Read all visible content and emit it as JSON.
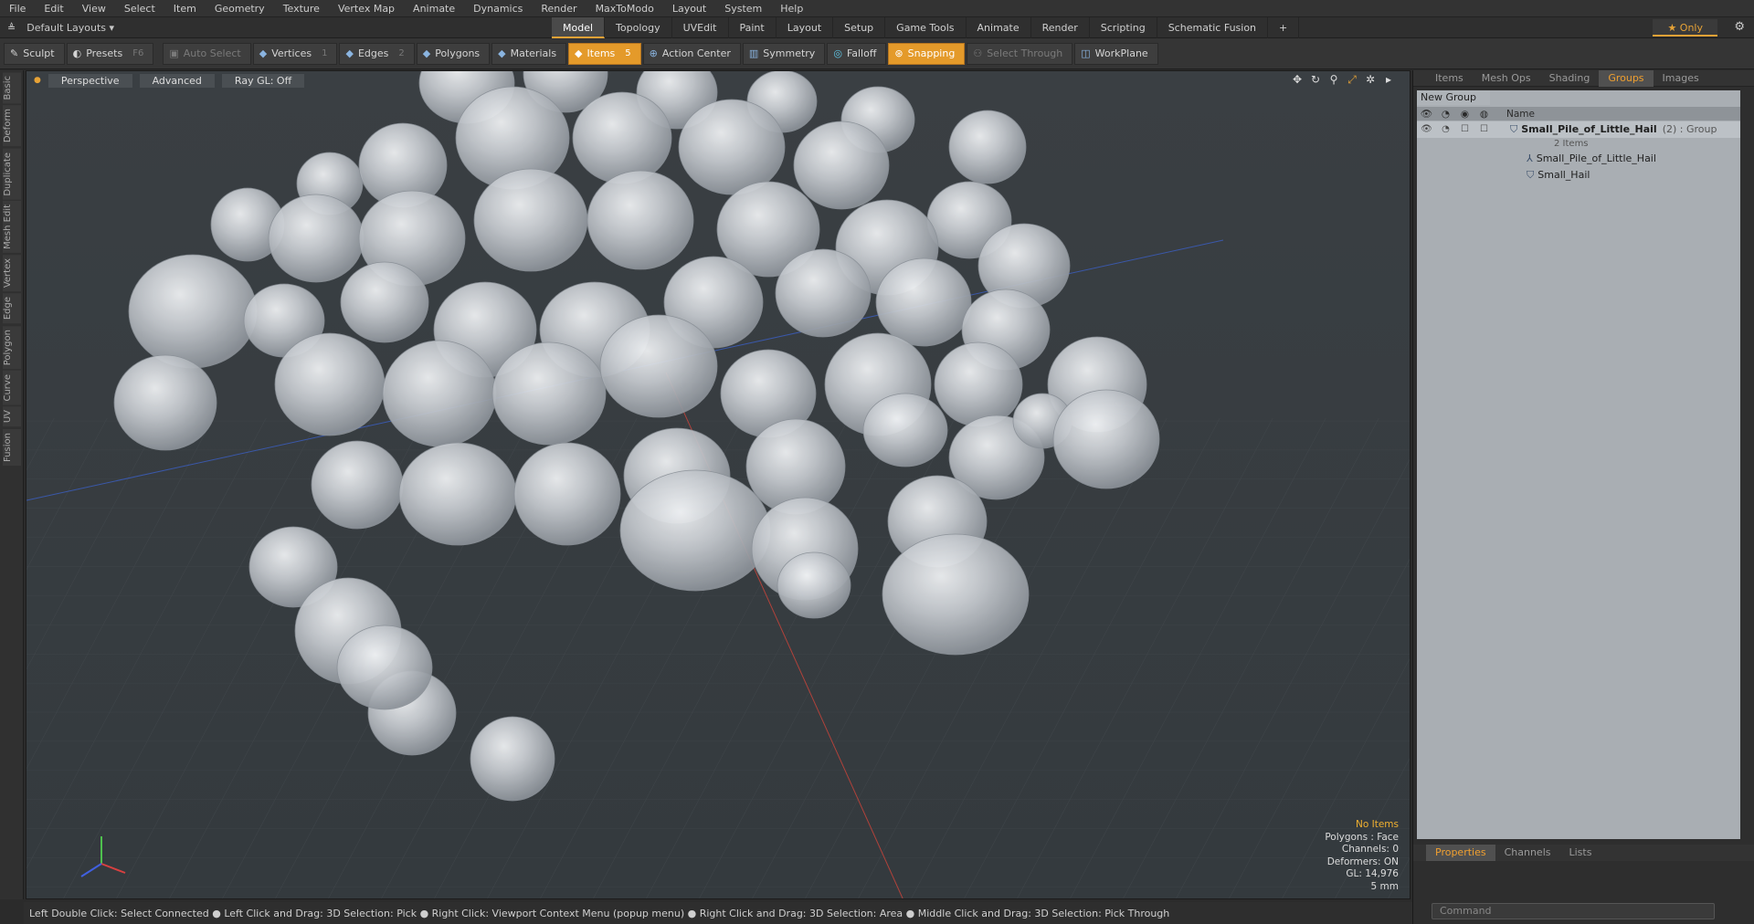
{
  "menubar": [
    "File",
    "Edit",
    "View",
    "Select",
    "Item",
    "Geometry",
    "Texture",
    "Vertex Map",
    "Animate",
    "Dynamics",
    "Render",
    "MaxToModo",
    "Layout",
    "System",
    "Help"
  ],
  "layout": {
    "selector": "Default Layouts ▾",
    "only": "Only"
  },
  "layout_tabs": [
    "Model",
    "Topology",
    "UVEdit",
    "Paint",
    "Layout",
    "Setup",
    "Game Tools",
    "Animate",
    "Render",
    "Scripting",
    "Schematic Fusion"
  ],
  "layout_active": "Model",
  "toolbar": {
    "sculpt": "Sculpt",
    "presets": "Presets",
    "presets_key": "F6",
    "auto_select": "Auto Select",
    "vertices": "Vertices",
    "vertices_count": "1",
    "edges": "Edges",
    "edges_count": "2",
    "polygons": "Polygons",
    "materials": "Materials",
    "items": "Items",
    "items_count": "5",
    "action_center": "Action Center",
    "symmetry": "Symmetry",
    "falloff": "Falloff",
    "snapping": "Snapping",
    "select_through": "Select Through",
    "workplane": "WorkPlane"
  },
  "left_tabs": [
    "Basic",
    "Deform",
    "Duplicate",
    "Mesh Edit",
    "Vertex",
    "Edge",
    "Polygon",
    "Curve",
    "UV",
    "Fusion"
  ],
  "viewport": {
    "perspective": "Perspective",
    "advanced": "Advanced",
    "raygl": "Ray GL: Off",
    "info": {
      "no_items": "No Items",
      "polygons": "Polygons : Face",
      "channels": "Channels: 0",
      "deformers": "Deformers: ON",
      "gl": "GL: 14,976",
      "scale": "5 mm"
    }
  },
  "status": "Left Double Click: Select Connected ● Left Click and Drag: 3D Selection: Pick ● Right Click: Viewport Context Menu (popup menu) ● Right Click and Drag: 3D Selection: Area ● Middle Click and Drag: 3D Selection: Pick Through",
  "right_panel": {
    "tabs": [
      "Items",
      "Mesh Ops",
      "Shading",
      "Groups",
      "Images"
    ],
    "active_tab": "Groups",
    "new_group": "New Group",
    "col_name": "Name",
    "group_name": "Small_Pile_of_Little_Hail",
    "group_meta": "(2) : Group",
    "group_count": "2 Items",
    "children": [
      "Small_Pile_of_Little_Hail",
      "Small_Hail"
    ],
    "bottom_tabs": [
      "Properties",
      "Channels",
      "Lists"
    ],
    "command_placeholder": "Command"
  },
  "colors": {
    "accent": "#e6a236",
    "viewport_bg": "#383d41",
    "panel_bg": "#a9aeb3"
  }
}
